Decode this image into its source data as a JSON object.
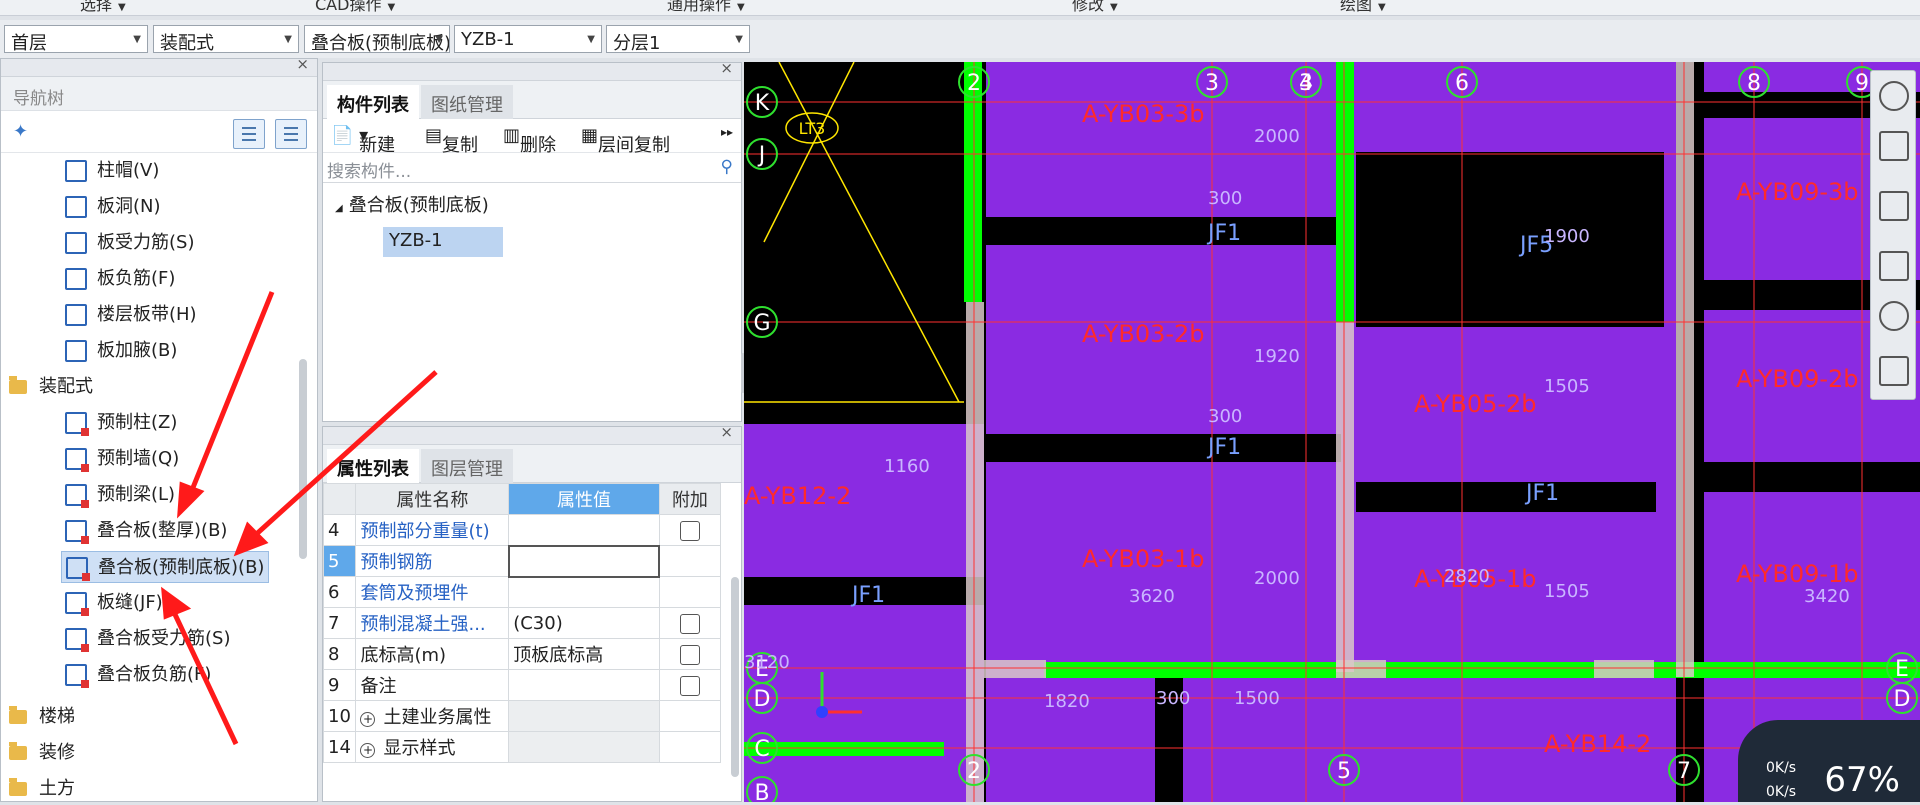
{
  "ribbon": {
    "groups": [
      "选择",
      "CAD操作",
      "通用操作",
      "修改",
      "绘图"
    ]
  },
  "selectors": [
    {
      "value": "首层"
    },
    {
      "value": "装配式"
    },
    {
      "value": "叠合板(预制底板)"
    },
    {
      "value": "YZB-1"
    },
    {
      "value": "分层1"
    }
  ],
  "nav": {
    "title": "导航树",
    "items": [
      {
        "label": "柱帽(V)"
      },
      {
        "label": "板洞(N)"
      },
      {
        "label": "板受力筋(S)"
      },
      {
        "label": "板负筋(F)"
      },
      {
        "label": "楼层板带(H)"
      },
      {
        "label": "板加腋(B)"
      }
    ],
    "folder_assembly": "装配式",
    "assembly_items": [
      {
        "label": "预制柱(Z)"
      },
      {
        "label": "预制墙(Q)"
      },
      {
        "label": "预制梁(L)"
      },
      {
        "label": "叠合板(整厚)(B)"
      },
      {
        "label": "叠合板(预制底板)(B)"
      },
      {
        "label": "板缝(JF)"
      },
      {
        "label": "叠合板受力筋(S)"
      },
      {
        "label": "叠合板负筋(F)"
      }
    ],
    "folder_stairs": "楼梯",
    "folder_decoration": "装修",
    "folder_earth": "土方"
  },
  "components": {
    "tab_list": "构件列表",
    "tab_drawings": "图纸管理",
    "new": "新建",
    "copy": "复制",
    "delete": "删除",
    "floor_copy": "层间复制",
    "search_placeholder": "搜索构件...",
    "tree_parent": "叠合板(预制底板)",
    "tree_child": "YZB-1"
  },
  "properties": {
    "tab_list": "属性列表",
    "tab_layers": "图层管理",
    "col_name": "属性名称",
    "col_value": "属性值",
    "col_extra": "附加",
    "rows": [
      {
        "num": "4",
        "name": "预制部分重量(t)",
        "value": "",
        "check": true,
        "link": true
      },
      {
        "num": "5",
        "name": "预制钢筋",
        "value": "",
        "check": false,
        "link": true
      },
      {
        "num": "6",
        "name": "套筒及预埋件",
        "value": "",
        "check": false,
        "link": true
      },
      {
        "num": "7",
        "name": "预制混凝土强...",
        "value": "(C30)",
        "check": true,
        "link": true
      },
      {
        "num": "8",
        "name": "底标高(m)",
        "value": "顶板底标高",
        "check": true,
        "link": false
      },
      {
        "num": "9",
        "name": "备注",
        "value": "",
        "check": true,
        "link": false
      },
      {
        "num": "10",
        "name": "土建业务属性",
        "value": "",
        "check": false,
        "link": false,
        "expand": true
      },
      {
        "num": "14",
        "name": "显示样式",
        "value": "",
        "check": false,
        "link": false,
        "expand": true
      }
    ]
  },
  "cad": {
    "axis_top": [
      "2",
      "3",
      "4",
      "6",
      "8",
      "9"
    ],
    "axis_left": [
      "K",
      "J",
      "G",
      "E",
      "D",
      "C",
      "B"
    ],
    "axis_bottom": [
      "2",
      "5",
      "7"
    ],
    "axis_right": [
      "E",
      "D"
    ],
    "slab_labels": [
      "A-YB03-3b",
      "A-YB03-2b",
      "A-YB03-1b",
      "A-YB09-3b",
      "A-YB09-2b",
      "A-YB09-1b",
      "A-YB05-2b",
      "A-YB12-2",
      "A-YB14-2"
    ],
    "partial_labels": [
      "A-YB05-1b"
    ],
    "jf_labels": [
      "JF1",
      "JF5",
      "JF1",
      "JF1",
      "JF1"
    ],
    "dims": [
      "2000",
      "1920",
      "2000",
      "1505",
      "1505",
      "3620",
      "3420",
      "1820",
      "300",
      "1500",
      "1900",
      "300",
      "300",
      "1160",
      "2820",
      "3120"
    ],
    "beam_tag": "LT3",
    "colors": {
      "slab": "#8a2be2",
      "beam": "#00ff00",
      "grid": "#ff0000",
      "text": "#ff2a2a",
      "wall": "#d9c8c8"
    }
  },
  "network": {
    "up": "0K/s",
    "down": "0K/s",
    "percent": "67%"
  }
}
